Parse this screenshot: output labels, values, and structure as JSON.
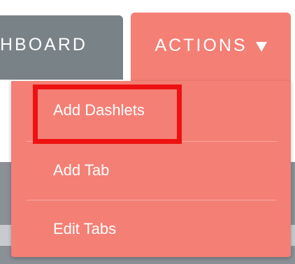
{
  "tabs": {
    "dashboard_label": "HBOARD",
    "actions_label": "ACTIONS"
  },
  "menu": {
    "items": [
      {
        "label": "Add Dashlets"
      },
      {
        "label": "Add Tab"
      },
      {
        "label": "Edit Tabs"
      }
    ]
  },
  "colors": {
    "actions_bg": "#f47f75",
    "dashboard_bg": "#798287",
    "highlight_border": "#ee1111"
  },
  "icons": {
    "actions_caret": "caret-down-icon"
  }
}
